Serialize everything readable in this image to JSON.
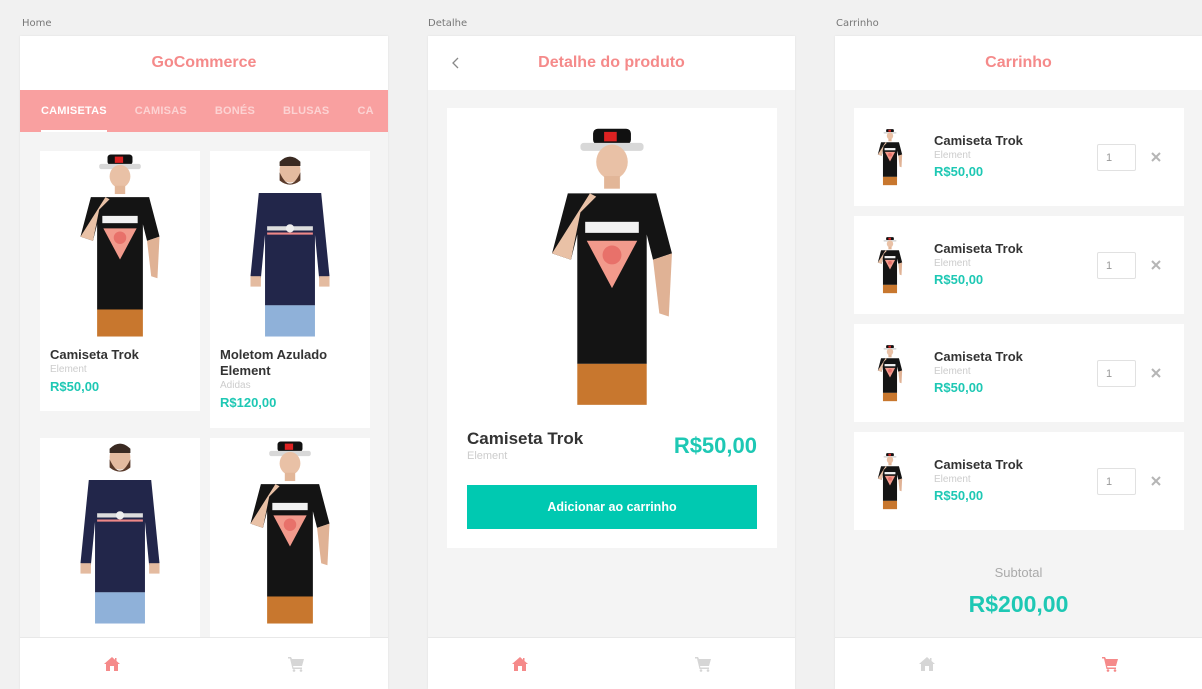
{
  "frames": {
    "home": "Home",
    "detail": "Detalhe",
    "cart": "Carrinho"
  },
  "colors": {
    "brand": "#f58a8a",
    "nav_bg": "#f9a0a0",
    "accent": "#00c9b1",
    "price": "#1ec8b4"
  },
  "home": {
    "title": "GoCommerce",
    "categories": [
      {
        "label": "CAMISETAS",
        "active": true
      },
      {
        "label": "CAMISAS"
      },
      {
        "label": "BONÉS"
      },
      {
        "label": "BLUSAS"
      },
      {
        "label": "CA"
      }
    ],
    "products": [
      {
        "name": "Camiseta Trok",
        "brand": "Element",
        "price": "R$50,00",
        "image": "black-tee-model"
      },
      {
        "name": "Moletom Azulado Element",
        "brand": "Adidas",
        "price": "R$120,00",
        "image": "navy-hoodie-model"
      },
      {
        "image": "navy-hoodie-model"
      },
      {
        "image": "black-tee-model"
      }
    ]
  },
  "detail": {
    "title": "Detalhe do produto",
    "product": {
      "name": "Camiseta Trok",
      "brand": "Element",
      "price": "R$50,00",
      "image": "black-tee-model"
    },
    "button": "Adicionar ao carrinho"
  },
  "cart": {
    "title": "Carrinho",
    "items": [
      {
        "name": "Camiseta Trok",
        "brand": "Element",
        "price": "R$50,00",
        "qty": "1"
      },
      {
        "name": "Camiseta Trok",
        "brand": "Element",
        "price": "R$50,00",
        "qty": "1"
      },
      {
        "name": "Camiseta Trok",
        "brand": "Element",
        "price": "R$50,00",
        "qty": "1"
      },
      {
        "name": "Camiseta Trok",
        "brand": "Element",
        "price": "R$50,00",
        "qty": "1"
      }
    ],
    "subtotal_label": "Subtotal",
    "subtotal_value": "R$200,00"
  },
  "icons": {
    "home": "home-icon",
    "cart": "cart-icon",
    "back": "chevron-left-icon",
    "remove": "close-icon"
  }
}
